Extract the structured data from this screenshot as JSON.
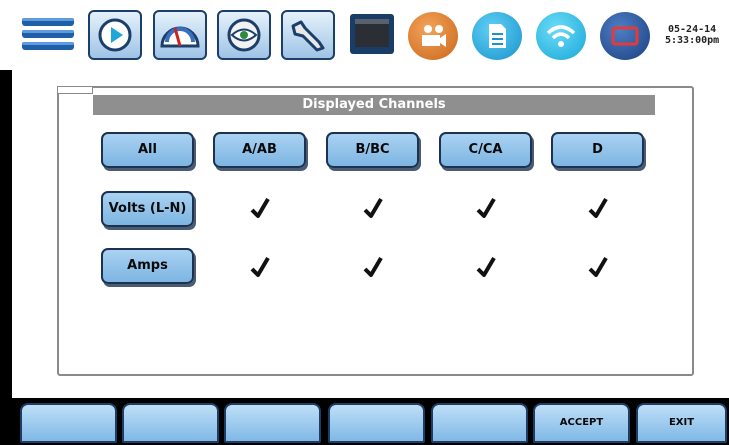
{
  "status": {
    "date": "05-24-14",
    "time": "5:33:00pm"
  },
  "toolbar": {
    "icons": [
      "menu-icon",
      "play-icon",
      "gauge-icon",
      "eye-icon",
      "wrench-icon",
      "monitor-icon",
      "camera-icon",
      "document-icon",
      "wifi-icon",
      "screen-icon"
    ]
  },
  "panel": {
    "title": "Displayed Channels",
    "channels": [
      "All",
      "A/AB",
      "B/BC",
      "C/CA",
      "D"
    ],
    "rows": [
      {
        "label": "Volts (L-N)",
        "checked": [
          true,
          true,
          true,
          true
        ]
      },
      {
        "label": "Amps",
        "checked": [
          true,
          true,
          true,
          true
        ]
      }
    ]
  },
  "footer": {
    "buttons": [
      "",
      "",
      "",
      "",
      "",
      "ACCEPT",
      "EXIT"
    ]
  },
  "colors": {
    "accent": "#7db5e2",
    "dark_blue": "#1b3f6a",
    "orange": "#d77b23",
    "cyan": "#27b4e6",
    "navy": "#1f4e8c"
  }
}
